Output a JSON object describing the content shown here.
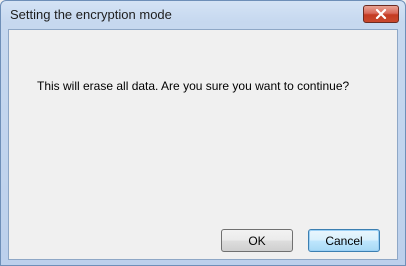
{
  "dialog": {
    "title": "Setting the encryption mode",
    "message": "This will erase all data. Are you sure you want to continue?",
    "buttons": {
      "ok_label": "OK",
      "cancel_label": "Cancel"
    },
    "close_icon": "close-icon",
    "colors": {
      "close_button": "#c43b22",
      "focused_button_border": "#3c7fb1"
    }
  }
}
